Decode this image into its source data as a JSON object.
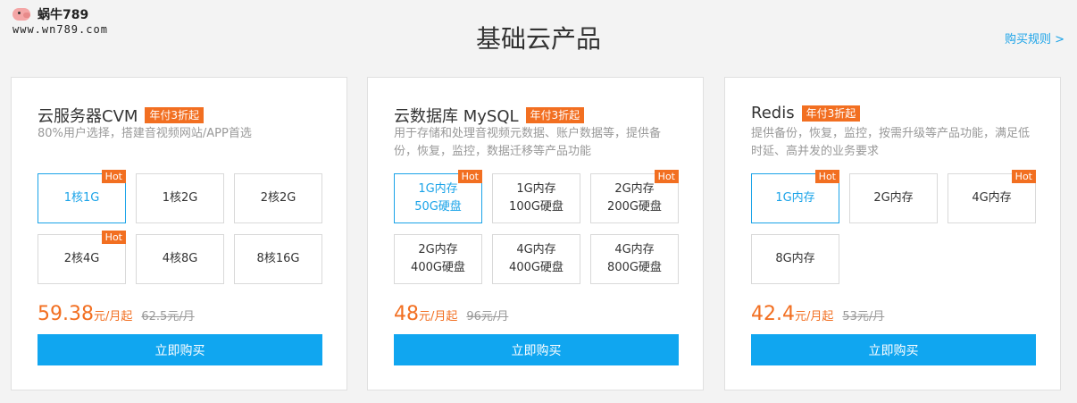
{
  "watermark": {
    "brand": "蜗牛789",
    "url": "www.wn789.com"
  },
  "header": {
    "title": "基础云产品",
    "rules_link": "购买规则 >"
  },
  "cards": [
    {
      "name": "云服务器CVM",
      "badge": "年付3折起",
      "desc": "80%用户选择，搭建音视频网站/APP首选",
      "options": [
        {
          "label": "1核1G",
          "selected": true,
          "hot": "Hot"
        },
        {
          "label": "1核2G"
        },
        {
          "label": "2核2G"
        },
        {
          "label": "2核4G",
          "hot": "Hot"
        },
        {
          "label": "4核8G"
        },
        {
          "label": "8核16G"
        }
      ],
      "price": "59.38",
      "price_unit": "元/月起",
      "orig_price": "62.5元/月",
      "buy": "立即购买"
    },
    {
      "name": "云数据库 MySQL",
      "badge": "年付3折起",
      "desc": "用于存储和处理音视频元数据、账户数据等，提供备份，恢复，监控，数据迁移等产品功能",
      "options": [
        {
          "line1": "1G内存",
          "line2": "50G硬盘",
          "selected": true,
          "hot": "Hot"
        },
        {
          "line1": "1G内存",
          "line2": "100G硬盘"
        },
        {
          "line1": "2G内存",
          "line2": "200G硬盘",
          "hot": "Hot"
        },
        {
          "line1": "2G内存",
          "line2": "400G硬盘"
        },
        {
          "line1": "4G内存",
          "line2": "400G硬盘"
        },
        {
          "line1": "4G内存",
          "line2": "800G硬盘"
        }
      ],
      "price": "48",
      "price_unit": "元/月起",
      "orig_price": "96元/月",
      "buy": "立即购买"
    },
    {
      "name": "Redis",
      "badge": "年付3折起",
      "desc": "提供备份，恢复，监控，按需升级等产品功能，满足低时延、高并发的业务要求",
      "options": [
        {
          "label": "1G内存",
          "selected": true,
          "hot": "Hot"
        },
        {
          "label": "2G内存"
        },
        {
          "label": "4G内存",
          "hot": "Hot"
        },
        {
          "label": "8G内存"
        }
      ],
      "price": "42.4",
      "price_unit": "元/月起",
      "orig_price": "53元/月",
      "buy": "立即购买"
    }
  ],
  "colors": {
    "accent": "#1aa3e8",
    "orange": "#f26f21",
    "button": "#10a6f0"
  }
}
